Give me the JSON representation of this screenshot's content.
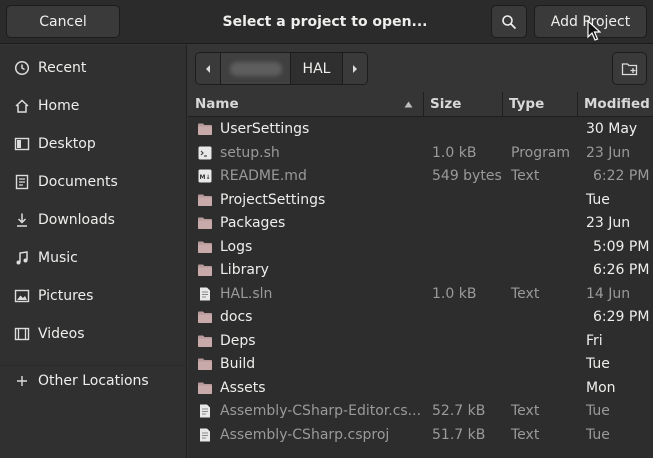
{
  "header": {
    "cancel_label": "Cancel",
    "title": "Select a project to open...",
    "search_icon": "search-icon",
    "add_project_label": "Add Project"
  },
  "sidebar": {
    "items": [
      {
        "label": "Recent",
        "icon": "clock-icon"
      },
      {
        "label": "Home",
        "icon": "home-icon"
      },
      {
        "label": "Desktop",
        "icon": "desktop-icon"
      },
      {
        "label": "Documents",
        "icon": "document-icon"
      },
      {
        "label": "Downloads",
        "icon": "download-icon"
      },
      {
        "label": "Music",
        "icon": "music-icon"
      },
      {
        "label": "Pictures",
        "icon": "picture-icon"
      },
      {
        "label": "Videos",
        "icon": "video-icon"
      },
      {
        "label": "Other Locations",
        "icon": "plus-icon"
      }
    ]
  },
  "pathbar": {
    "parent_label": "",
    "current_label": "HAL"
  },
  "columns": {
    "name": "Name",
    "size": "Size",
    "type": "Type",
    "modified": "Modified"
  },
  "files": [
    {
      "name": "UserSettings",
      "size": "",
      "type": "",
      "modified": "30 May",
      "kind": "folder"
    },
    {
      "name": "setup.sh",
      "size": "1.0 kB",
      "type": "Program",
      "modified": "23 Jun",
      "kind": "script"
    },
    {
      "name": "README.md",
      "size": "549 bytes",
      "type": "Text",
      "modified": "6:22 PM",
      "kind": "markdown"
    },
    {
      "name": "ProjectSettings",
      "size": "",
      "type": "",
      "modified": "Tue",
      "kind": "folder"
    },
    {
      "name": "Packages",
      "size": "",
      "type": "",
      "modified": "23 Jun",
      "kind": "folder"
    },
    {
      "name": "Logs",
      "size": "",
      "type": "",
      "modified": "5:09 PM",
      "kind": "folder"
    },
    {
      "name": "Library",
      "size": "",
      "type": "",
      "modified": "6:26 PM",
      "kind": "folder"
    },
    {
      "name": "HAL.sln",
      "size": "1.0 kB",
      "type": "Text",
      "modified": "14 Jun",
      "kind": "text"
    },
    {
      "name": "docs",
      "size": "",
      "type": "",
      "modified": "6:29 PM",
      "kind": "folder"
    },
    {
      "name": "Deps",
      "size": "",
      "type": "",
      "modified": "Fri",
      "kind": "folder"
    },
    {
      "name": "Build",
      "size": "",
      "type": "",
      "modified": "Tue",
      "kind": "folder"
    },
    {
      "name": "Assets",
      "size": "",
      "type": "",
      "modified": "Mon",
      "kind": "folder"
    },
    {
      "name": "Assembly-CSharp-Editor.cs...",
      "size": "52.7 kB",
      "type": "Text",
      "modified": "Tue",
      "kind": "text"
    },
    {
      "name": "Assembly-CSharp.csproj",
      "size": "51.7 kB",
      "type": "Text",
      "modified": "Tue",
      "kind": "text"
    }
  ],
  "colors": {
    "folder": "#c9a3a3",
    "accent": "#eeeeec",
    "dim_text": "#9a9a9a"
  }
}
